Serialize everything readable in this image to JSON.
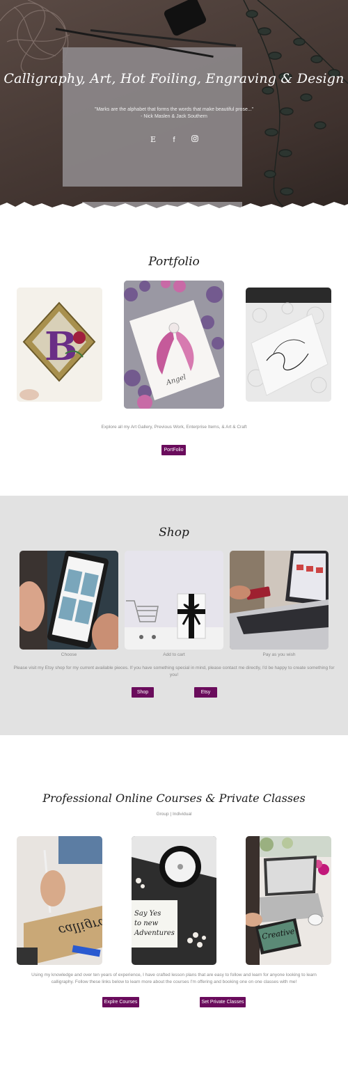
{
  "hero": {
    "title": "Calligraphy, Art, Hot Foiling, Engraving & Design",
    "quote_line1": "\"Marks are the alphabet that forms the words that make beautiful prose...\"",
    "quote_line2": "- Nick Maslen & Jack Southern",
    "social": [
      {
        "icon": "etsy-icon",
        "glyph": "E"
      },
      {
        "icon": "facebook-icon",
        "glyph": "f"
      },
      {
        "icon": "instagram-icon",
        "glyph": "◎"
      }
    ]
  },
  "portfolio": {
    "heading": "Portfolio",
    "description": "Explore all my Art Gallery, Previous Work, Enterprise Items, & Art & Craft",
    "button_label": "PortFolio",
    "images": [
      {
        "name": "illuminated-letter-b-image"
      },
      {
        "name": "angel-wings-card-image"
      },
      {
        "name": "lace-calligraphy-card-image"
      }
    ]
  },
  "shop": {
    "heading": "Shop",
    "items": [
      {
        "caption": "Choose"
      },
      {
        "caption": "Add to cart"
      },
      {
        "caption": "Pay as you wish"
      }
    ],
    "description_line1": "Please visit my Etsy shop for my current available pieces. If you have something special in mind, please contact me directly, I'd be happy to create something for",
    "description_line2": "you!",
    "shop_button": "Shop",
    "etsy_button": "Etsy"
  },
  "courses": {
    "heading": "Professional Online Courses & Private Classes",
    "subheading": "Group | Individual",
    "description_line1": "Using my knowledge and over ten years of experience, I have crafted lesson plans that are easy to follow and learn for anyone looking to learn",
    "description_line2": "calligraphy. Follow these links below to learn more about the courses I'm offering and booking one on one classes with me!",
    "courses_button": "Explre Courses",
    "private_button": "Set Private Classes",
    "image_text_1": "calligra",
    "image_text_2": "Say Yes to new Adventures",
    "image_text_3": "Creative"
  },
  "colors": {
    "accent": "#6a0c5c",
    "shop_bg": "#e2e2e2"
  }
}
